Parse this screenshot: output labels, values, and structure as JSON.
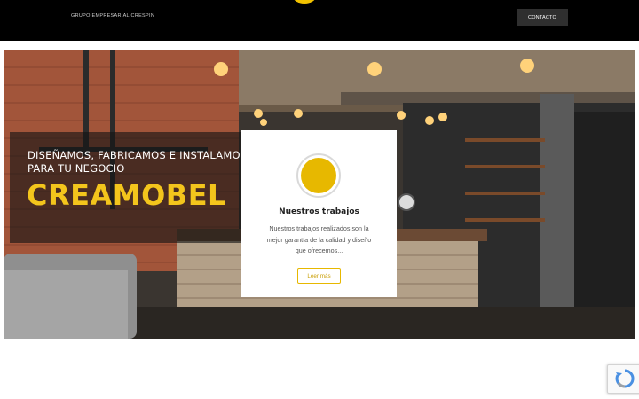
{
  "header": {
    "brand": "GRUPO EMPRESARIAL CRESPIN",
    "contact_label": "CONTACTO"
  },
  "hero": {
    "tagline": "DISEÑAMOS, FABRICAMOS E INSTALAMOS SOLUCIONES PARA TU NEGOCIO",
    "brand_name": "CREAMOBEL"
  },
  "card": {
    "title": "Nuestros trabajos",
    "text": "Nuestros trabajos realizados son la mejor garantía de la calidad y diseño que ofrecemos...",
    "button_label": "Leer más"
  },
  "icons": {
    "logo": "sun-logo-icon",
    "card": "circle-icon",
    "recaptcha": "recaptcha-icon"
  },
  "colors": {
    "accent": "#f3c51c",
    "header_bg": "#000000",
    "button_dark": "#2f2f2f"
  }
}
